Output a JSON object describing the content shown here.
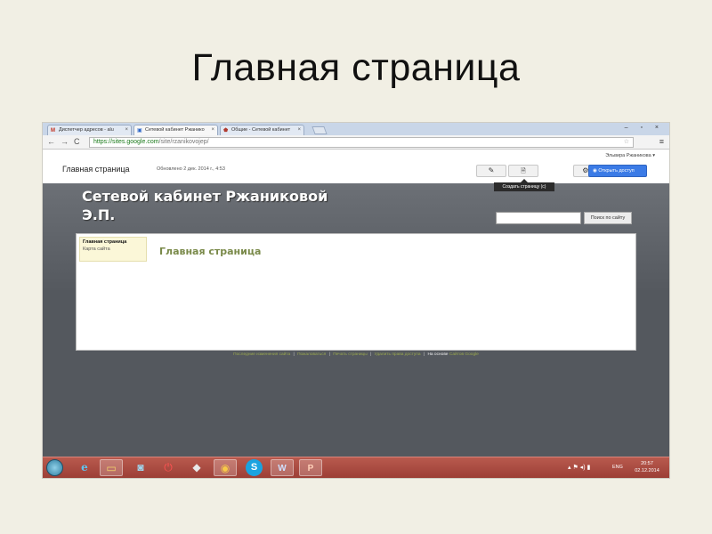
{
  "slide": {
    "title": "Главная страница"
  },
  "browser": {
    "tabs": [
      {
        "label": "Диспетчер адресов - alu",
        "icon": "gmail-icon"
      },
      {
        "label": "Сетевой кабинет Ржанико",
        "icon": "google-sites-icon"
      },
      {
        "label": "Общие - Сетевой кабинет",
        "icon": "shield-icon"
      }
    ],
    "tab_close": "×",
    "window_controls": "– ▫ ×",
    "nav": {
      "back": "←",
      "forward": "→",
      "reload": "C"
    },
    "url_host": "https://sites.google.com",
    "url_path": "/site/rzanikovojep/",
    "star": "☆",
    "menu": "≡"
  },
  "sites_header": {
    "user": "Эльвира Ржаникова ▾",
    "page_title": "Главная страница",
    "updated": "Обновлено 2 дек. 2014 г., 4:53",
    "edit_icon": "✎",
    "new_page_icon": "🗎",
    "settings_icon": "⚙ ▾",
    "share_button": "Открыть доступ",
    "tooltip": "Создать страницу (c)"
  },
  "banner": {
    "site_name": "Сетевой кабинет Ржаниковой Э.П.",
    "search_placeholder": "",
    "search_button": "Поиск по сайту"
  },
  "sidebar": {
    "items": [
      {
        "label": "Главная страница"
      },
      {
        "label": "Карта сайта"
      }
    ]
  },
  "content": {
    "title": "Главная страница"
  },
  "footer": {
    "links": [
      "Последние изменения сайта",
      "Пожаловаться",
      "Печать страницы",
      "Удалить права доступа"
    ],
    "powered": "На основе",
    "powered_link": "Сайтов Google",
    "separator": "|"
  },
  "taskbar": {
    "apps": [
      {
        "icon": "internet-explorer-icon",
        "glyph": "e"
      },
      {
        "icon": "file-explorer-icon",
        "glyph": "▭"
      },
      {
        "icon": "skype-app-icon",
        "glyph": "◙"
      },
      {
        "icon": "power-app-icon",
        "glyph": "⏻"
      },
      {
        "icon": "media-app-icon",
        "glyph": "◆"
      },
      {
        "icon": "chrome-icon",
        "glyph": "◉"
      },
      {
        "icon": "skype-icon",
        "glyph": "S"
      },
      {
        "icon": "word-icon",
        "glyph": "W"
      },
      {
        "icon": "powerpoint-icon",
        "glyph": "P"
      }
    ],
    "tray": "▴ ⚑ ◂) ▮",
    "lang": "ENG",
    "time": "20:57",
    "date": "02.12.2014"
  }
}
